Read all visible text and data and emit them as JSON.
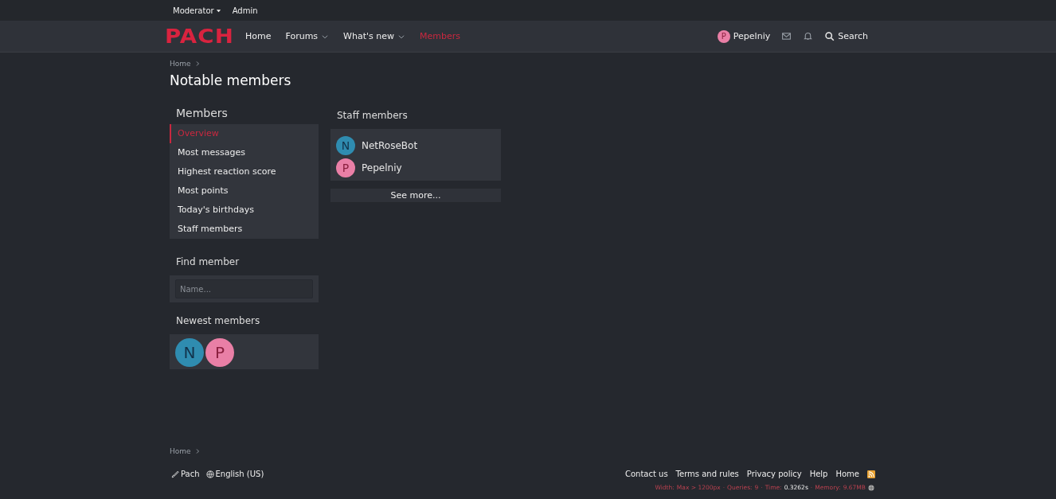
{
  "staff_bar": {
    "items": [
      {
        "label": "Moderator",
        "has_menu": true
      },
      {
        "label": "Admin",
        "has_menu": false
      }
    ]
  },
  "nav": {
    "logo": "PACH",
    "tabs": [
      {
        "label": "Home",
        "has_menu": false,
        "selected": false
      },
      {
        "label": "Forums",
        "has_menu": true,
        "selected": false
      },
      {
        "label": "What's new",
        "has_menu": true,
        "selected": false
      },
      {
        "label": "Members",
        "has_menu": false,
        "selected": true
      }
    ],
    "user": {
      "initial": "P",
      "name": "Pepelniy",
      "color": "#e97fa6"
    },
    "search": "Search"
  },
  "breadcrumb": [
    "Home"
  ],
  "title": "Notable members",
  "sidebar": {
    "heading": "Members",
    "items": [
      {
        "label": "Overview",
        "selected": true
      },
      {
        "label": "Most messages",
        "selected": false
      },
      {
        "label": "Highest reaction score",
        "selected": false
      },
      {
        "label": "Most points",
        "selected": false
      },
      {
        "label": "Today's birthdays",
        "selected": false
      },
      {
        "label": "Staff members",
        "selected": false
      }
    ],
    "find_heading": "Find member",
    "find_placeholder": "Name...",
    "newest_heading": "Newest members",
    "newest": [
      {
        "initial": "N",
        "color": "#2f8cb0"
      },
      {
        "initial": "P",
        "color": "#e97fa6"
      }
    ]
  },
  "staff": {
    "heading": "Staff members",
    "members": [
      {
        "initial": "N",
        "name": "NetRoseBot",
        "color": "#2f8cb0"
      },
      {
        "initial": "P",
        "name": "Pepelniy",
        "color": "#e97fa6"
      }
    ],
    "more": "See more..."
  },
  "footer": {
    "breadcrumb": [
      "Home"
    ],
    "style": "Pach",
    "language": "English (US)",
    "links": [
      "Contact us",
      "Terms and rules",
      "Privacy policy",
      "Help",
      "Home"
    ],
    "debug": [
      {
        "label": "Width:",
        "value": "Max > 1200px",
        "highlight": false
      },
      {
        "label": "Queries:",
        "value": "9",
        "highlight": false
      },
      {
        "label": "Time:",
        "value": "0.3262s",
        "highlight": true
      },
      {
        "label": "Memory:",
        "value": "9.67MB",
        "highlight": false
      }
    ],
    "separator": "·"
  }
}
